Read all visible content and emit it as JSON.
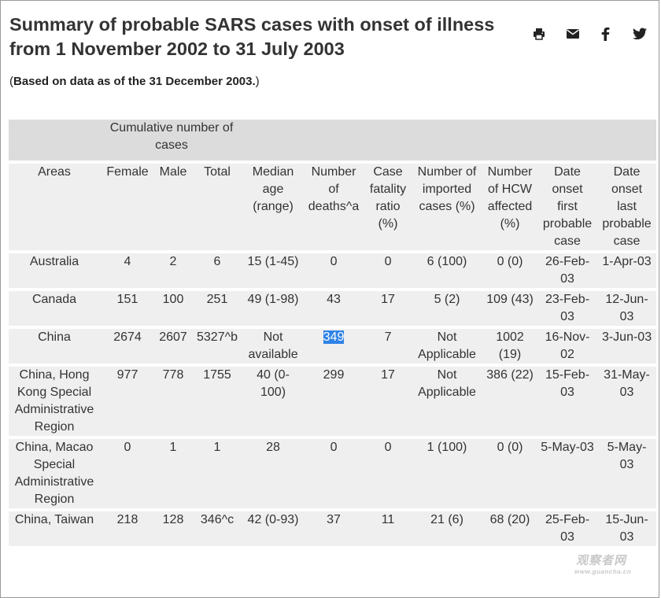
{
  "page": {
    "title": "Summary of probable SARS cases with onset of illness from 1 November 2002 to 31 July 2003",
    "subtitle_open": "(",
    "subtitle_bold": "Based on data as of the 31 December 2003.",
    "subtitle_close": ")"
  },
  "share": {
    "icons": [
      "print-icon",
      "email-icon",
      "facebook-icon",
      "twitter-icon"
    ]
  },
  "table": {
    "group_header": "Cumulative number of cases",
    "columns": [
      "Areas",
      "Female",
      "Male",
      "Total",
      "Median age (range)",
      "Number of deaths^a",
      "Case fatality ratio (%)",
      "Number of imported cases (%)",
      "Number of HCW affected (%)",
      "Date onset first probable case",
      "Date onset last probable case"
    ],
    "rows": [
      [
        "Australia",
        "4",
        "2",
        "6",
        "15 (1-45)",
        "0",
        "0",
        "6 (100)",
        "0 (0)",
        "26-Feb-03",
        "1-Apr-03"
      ],
      [
        "Canada",
        "151",
        "100",
        "251",
        "49 (1-98)",
        "43",
        "17",
        "5 (2)",
        "109 (43)",
        "23-Feb-03",
        "12-Jun-03"
      ],
      [
        "China",
        "2674",
        "2607",
        "5327^b",
        "Not available",
        "349",
        "7",
        "Not Applicable",
        "1002 (19)",
        "16-Nov-02",
        "3-Jun-03"
      ],
      [
        "China, Hong Kong Special Administrative Region",
        "977",
        "778",
        "1755",
        "40 (0-100)",
        "299",
        "17",
        "Not Applicable",
        "386 (22)",
        "15-Feb-03",
        "31-May-03"
      ],
      [
        "China, Macao Special Administrative Region",
        "0",
        "1",
        "1",
        "28",
        "0",
        "0",
        "1 (100)",
        "0 (0)",
        "5-May-03",
        "5-May-03"
      ],
      [
        "China, Taiwan",
        "218",
        "128",
        "346^c",
        "42 (0-93)",
        "37",
        "11",
        "21 (6)",
        "68 (20)",
        "25-Feb-03",
        "15-Jun-03"
      ]
    ],
    "highlighted_cell": "349"
  },
  "watermark": {
    "main": "观察者网",
    "sub": "www.guancha.cn"
  },
  "colors": {
    "group_header_bg": "#dcdcdc",
    "row_bg": "#efefef",
    "selection": "#2f83e6"
  }
}
